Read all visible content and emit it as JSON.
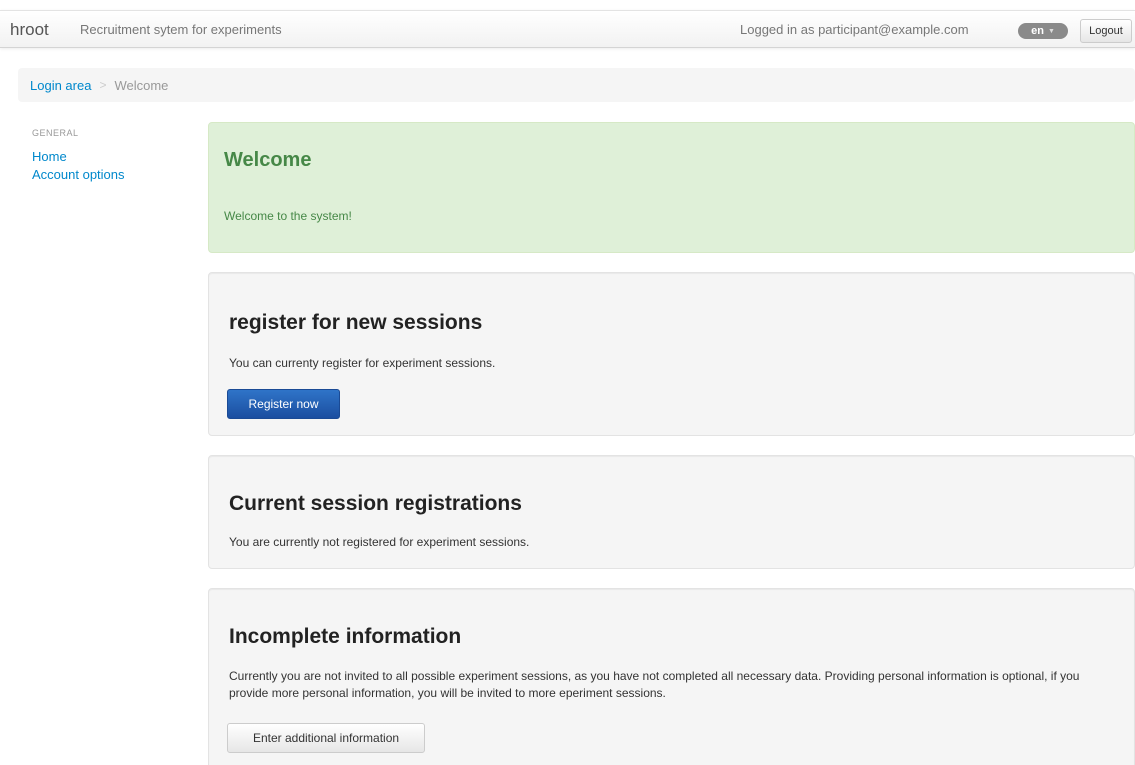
{
  "navbar": {
    "brand": "hroot",
    "tagline": "Recruitment sytem for experiments",
    "logged_in": "Logged in as participant@example.com",
    "language": "en",
    "logout": "Logout"
  },
  "breadcrumb": {
    "items": [
      "Login area",
      "Welcome"
    ],
    "divider": ">"
  },
  "sidebar": {
    "header": "GENERAL",
    "items": [
      "Home",
      "Account options"
    ]
  },
  "welcome": {
    "title": "Welcome",
    "message": "Welcome to the system!"
  },
  "register": {
    "title": "register for new sessions",
    "text": "You can currenty register for experiment sessions.",
    "button": "Register now"
  },
  "current": {
    "title": "Current session registrations",
    "text": "You are currently not registered for experiment sessions."
  },
  "incomplete": {
    "title": "Incomplete information",
    "text": "Currently you are not invited to all possible experiment sessions, as you have not completed all necessary data. Providing personal information is optional, if you provide more personal information, you will be invited to more eperiment sessions.",
    "button": "Enter additional information"
  },
  "colors": {
    "link": "#0088cc",
    "success_text": "#468847",
    "success_bg": "#dff0d8",
    "primary_button": "#1b4ea0"
  }
}
